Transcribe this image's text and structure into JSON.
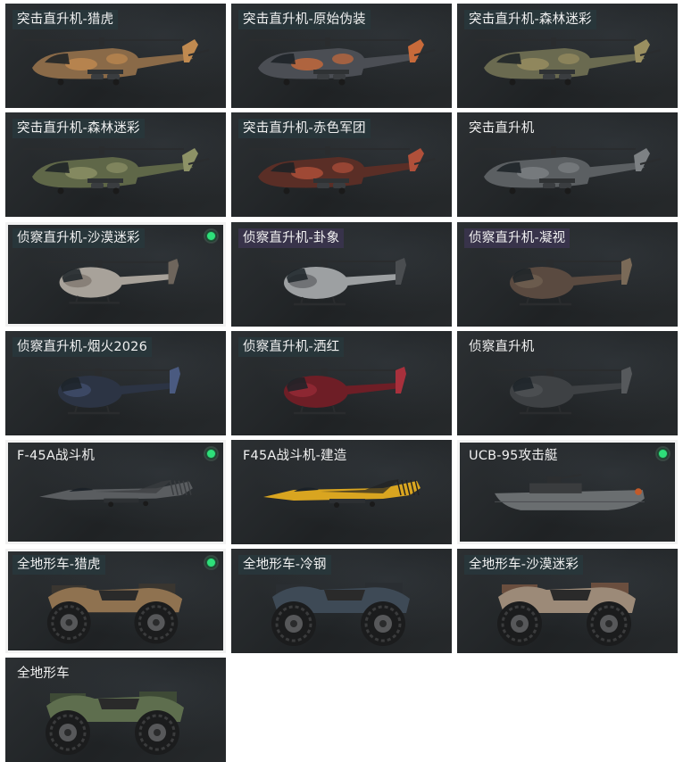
{
  "items": [
    {
      "label": "突击直升机-猎虎",
      "type": "attack-heli",
      "body": "#8a6a48",
      "accent": "#c08a50"
    },
    {
      "label": "突击直升机-原始伪装",
      "type": "attack-heli",
      "body": "#4b4e54",
      "accent": "#c86a3a"
    },
    {
      "label": "突击直升机-森林迷彩",
      "type": "attack-heli",
      "body": "#6a6a50",
      "accent": "#9a8f60"
    },
    {
      "label": "突击直升机-森林迷彩",
      "type": "attack-heli",
      "body": "#5f6748",
      "accent": "#8d9266"
    },
    {
      "label": "突击直升机-赤色军团",
      "type": "attack-heli",
      "body": "#5a2e26",
      "accent": "#b0503a"
    },
    {
      "label": "突击直升机",
      "type": "attack-heli",
      "body": "#5b5f62",
      "accent": "#7d8184"
    },
    {
      "label": "侦察直升机-沙漠迷彩",
      "type": "scout-heli",
      "body": "#a8a29a",
      "accent": "#6e655c",
      "selected": true,
      "equipped": true
    },
    {
      "label": "侦察直升机-卦象",
      "type": "scout-heli",
      "body": "#9da0a2",
      "accent": "#4a4d50"
    },
    {
      "label": "侦察直升机-凝视",
      "type": "scout-heli",
      "body": "#5a4a40",
      "accent": "#7a6a58"
    },
    {
      "label": "侦察直升机-烟火2026",
      "type": "scout-heli",
      "body": "#2c3444",
      "accent": "#4a5a80"
    },
    {
      "label": "侦察直升机-洒红",
      "type": "scout-heli",
      "body": "#6e1e26",
      "accent": "#a8303c"
    },
    {
      "label": "侦察直升机",
      "type": "scout-heli",
      "body": "#3e4144",
      "accent": "#56595c"
    },
    {
      "label": "F-45A战斗机",
      "type": "jet",
      "body": "#5a5d60",
      "accent": "#3a3d40",
      "selected": true,
      "equipped": true
    },
    {
      "label": "F45A战斗机-建造",
      "type": "jet",
      "body": "#d9a520",
      "accent": "#222222"
    },
    {
      "label": "UCB-95攻击艇",
      "type": "boat",
      "body": "#6a6e70",
      "accent": "#3a3c3e",
      "selected": true,
      "equipped": true
    },
    {
      "label": "全地形车-猎虎",
      "type": "atv",
      "body": "#8f7250",
      "accent": "#3a3630",
      "selected": true,
      "equipped": true
    },
    {
      "label": "全地形车-冷钢",
      "type": "atv",
      "body": "#3e4a56",
      "accent": "#2a2e32"
    },
    {
      "label": "全地形车-沙漠迷彩",
      "type": "atv",
      "body": "#9c8a78",
      "accent": "#6a4e3e"
    },
    {
      "label": "全地形车",
      "type": "atv",
      "body": "#5e6e4e",
      "accent": "#3e4a36"
    }
  ]
}
